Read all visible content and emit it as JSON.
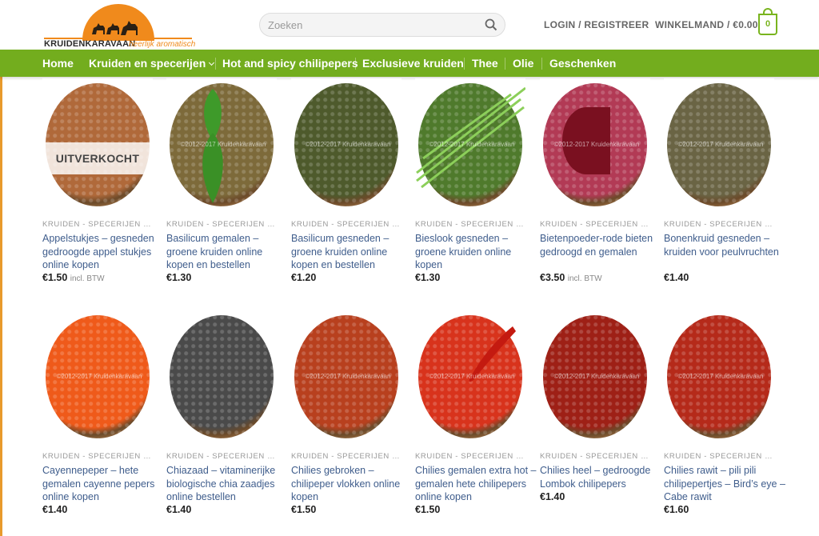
{
  "header": {
    "logo_name": "KRUIDENKARAVAAN",
    "logo_tagline": "heerlijk aromatisch",
    "search_placeholder": "Zoeken",
    "login_label": "LOGIN / REGISTREER",
    "cart_label": "WINKELMAND / €0.00",
    "cart_count": "0"
  },
  "nav": {
    "items": [
      {
        "label": "Home"
      },
      {
        "label": "Kruiden en specerijen"
      },
      {
        "label": "Hot and spicy chilipepers"
      },
      {
        "label": "Exclusieve kruiden"
      },
      {
        "label": "Thee"
      },
      {
        "label": "Olie"
      },
      {
        "label": "Geschenken"
      }
    ]
  },
  "watermark": "©2012-2017 Kruidenkaravaan",
  "products": [
    {
      "category": "KRUIDEN - SPECERIJEN ON...",
      "name": "Appelstukjes – gesneden gedroogde appel stukjes online kopen",
      "price": "€1.50",
      "vat": "incl. BTW",
      "badge": "UITVERKOCHT",
      "color": "#b0693a"
    },
    {
      "category": "KRUIDEN - SPECERIJEN ON...",
      "name": "Basilicum gemalen – groene kruiden online kopen en bestellen",
      "price": "€1.30",
      "vat": "",
      "badge": "",
      "color": "#7d6a3a"
    },
    {
      "category": "KRUIDEN - SPECERIJEN ON...",
      "name": "Basilicum gesneden – groene kruiden online kopen en bestellen",
      "price": "€1.20",
      "vat": "",
      "badge": "",
      "color": "#4e5a2c"
    },
    {
      "category": "KRUIDEN - SPECERIJEN ON...",
      "name": "Bieslook gesneden – groene kruiden online kopen",
      "price": "€1.30",
      "vat": "",
      "badge": "",
      "color": "#4f7a2c"
    },
    {
      "category": "KRUIDEN - SPECERIJEN ON...",
      "name": "Bietenpoeder-rode bieten gedroogd en gemalen",
      "price": "€3.50",
      "vat": "incl. BTW",
      "badge": "",
      "color": "#b23a55"
    },
    {
      "category": "KRUIDEN - SPECERIJEN ON...",
      "name": "Bonenkruid gesneden – kruiden voor peulvruchten",
      "price": "€1.40",
      "vat": "",
      "badge": "",
      "color": "#6a6444"
    },
    {
      "category": "KRUIDEN - SPECERIJEN ON...",
      "name": "Cayennepeper – hete gemalen cayenne pepers online kopen",
      "price": "€1.40",
      "vat": "",
      "badge": "",
      "color": "#ef5a1a"
    },
    {
      "category": "KRUIDEN - SPECERIJEN ON...",
      "name": "Chiazaad – vitaminerijke biologische chia zaadjes online bestellen",
      "price": "€1.40",
      "vat": "",
      "badge": "",
      "color": "#4a4a4a"
    },
    {
      "category": "KRUIDEN - SPECERIJEN ON...",
      "name": "Chilies gebroken – chilipeper vlokken online kopen",
      "price": "€1.50",
      "vat": "",
      "badge": "",
      "color": "#b8401e"
    },
    {
      "category": "KRUIDEN - SPECERIJEN ON...",
      "name": "Chilies gemalen extra hot – gemalen hete chilipepers online kopen",
      "price": "€1.50",
      "vat": "",
      "badge": "",
      "color": "#d8331c"
    },
    {
      "category": "KRUIDEN - SPECERIJEN ON...",
      "name": "Chilies heel – gedroogde Lombok chilipepers",
      "price": "€1.40",
      "vat": "",
      "badge": "",
      "color": "#9e2016"
    },
    {
      "category": "KRUIDEN - SPECERIJEN ON...",
      "name": "Chilies rawit – pili pili chilipepertjes – Bird’s eye – Cabe rawit",
      "price": "€1.60",
      "vat": "",
      "badge": "",
      "color": "#b52a1a"
    }
  ]
}
